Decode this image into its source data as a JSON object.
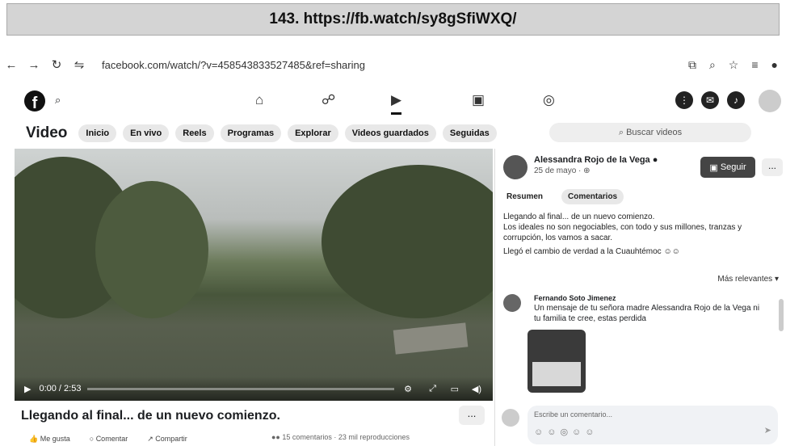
{
  "caption": "143. https://fb.watch/sy8gSfiWXQ/",
  "browser": {
    "url": "facebook.com/watch/?v=458543833527485&ref=sharing"
  },
  "videos_header": {
    "title": "Video",
    "tabs": [
      "Inicio",
      "En vivo",
      "Reels",
      "Programas",
      "Explorar",
      "Videos guardados",
      "Seguidas"
    ],
    "search_placeholder": "Buscar videos"
  },
  "player": {
    "time": "0:00 / 2:53"
  },
  "video": {
    "title": "Llegando al final... de un nuevo comienzo.",
    "more": "...",
    "like": "Me gusta",
    "comment": "Comentar",
    "share": "Compartir",
    "stats": "15 comentarios · 23 mil reproducciones"
  },
  "panel": {
    "author": "Alessandra Rojo de la Vega",
    "date": "25 de mayo ·",
    "follow": "Seguir",
    "more": "...",
    "tab_summary": "Resumen",
    "tab_comments": "Comentarios",
    "desc_1": "Llegando al final... de un nuevo comienzo.",
    "desc_2": "Los ideales no son negociables, con todo y sus millones, tranzas y corrupción, los vamos a sacar.",
    "desc_3": "Llegó el cambio de verdad a la Cuauhtémoc",
    "relevance": "Más relevantes",
    "comment_author": "Fernando Soto Jimenez",
    "comment_text": "Un mensaje de tu señora madre Alessandra Rojo de la Vega ni tu familia te cree, estas perdida",
    "input_placeholder": "Escribe un comentario..."
  }
}
